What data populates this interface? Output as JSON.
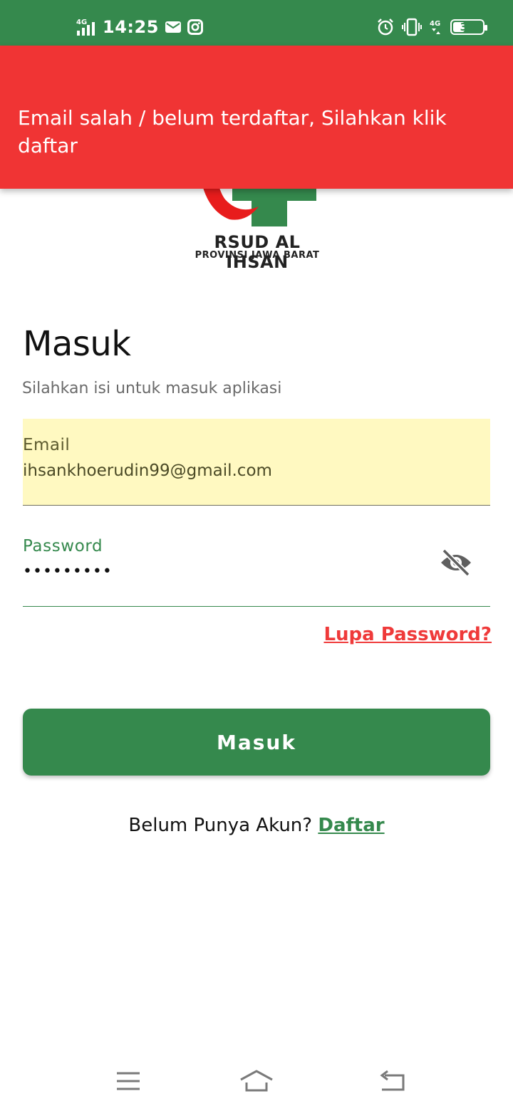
{
  "status_bar": {
    "time": "14:25",
    "network_left": "4G",
    "network_right": "4G",
    "battery_level": "39",
    "battery_fraction": 0.39,
    "icons": [
      "signal-icon",
      "mail-icon",
      "instagram-icon",
      "alarm-icon",
      "vibrate-icon",
      "network-icon",
      "battery-icon"
    ]
  },
  "banner": {
    "message": "Email salah / belum terdaftar, Silahkan klik daftar",
    "color": "#f03434"
  },
  "logo": {
    "title": "RSUD AL IHSAN",
    "subtitle": "PROVINSI JAWA BARAT"
  },
  "form": {
    "title": "Masuk",
    "subtitle": "Silahkan isi untuk masuk aplikasi",
    "email_label": "Email",
    "email_value": "ihsankhoerudin99@gmail.com",
    "password_label": "Password",
    "password_value": "•••••••••",
    "forgot_password": "Lupa Password?",
    "submit_label": "Masuk",
    "register_prompt": "Belum Punya Akun?",
    "register_link": "Daftar"
  },
  "colors": {
    "primary": "#35894d",
    "error": "#f03434",
    "autofill_bg": "#fff9c1"
  }
}
